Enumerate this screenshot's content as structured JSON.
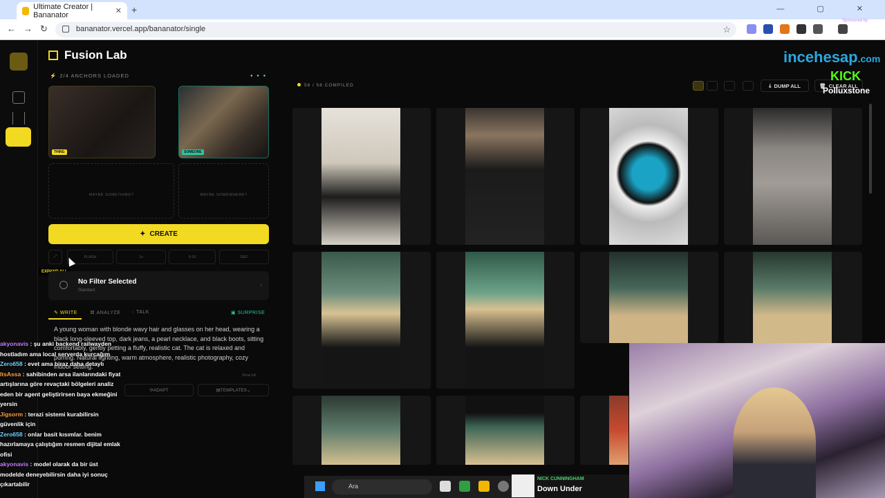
{
  "browser": {
    "tab_title": "Ultimate Creator | Bananator",
    "url": "bananator.vercel.app/bananator/single"
  },
  "app": {
    "title": "Fusion Lab",
    "anchors_status": "2/4 ANCHORS LOADED",
    "anchors": [
      {
        "tag": "THING"
      },
      {
        "tag": "SOMEONE"
      }
    ],
    "empty_slots": [
      "MAYBE SOMETHING?",
      "MAYBE SOMEWHERE?"
    ],
    "create_label": "CREATE",
    "tools": [
      "FLASH",
      "1x",
      "9:16",
      "DEF"
    ],
    "expand_tooltip": "EXPAND ALL",
    "filter": {
      "title": "No Filter Selected",
      "subtitle": "Standard"
    },
    "modes": {
      "write": "WRITE",
      "analyze": "ANALYZE",
      "talk": "TALK",
      "surprise": "SURPRISE"
    },
    "prompt_text": "A young woman with blonde wavy hair and glasses on her head, wearing a black long-sleeved top, dark jeans, a pearl necklace, and black boots, sitting comfortably, gently petting a fluffy, realistic cat. The cat is relaxed and purring. Natural lighting, warm atmosphere, realistic photography, cozy indoor setting.",
    "show_full": "Show full",
    "adapt_label": "ADAPT",
    "templates_label": "TEMPLATES"
  },
  "gallery": {
    "compiled": "56 / 56 COMPILED",
    "dump_all": "DUMP ALL",
    "clear_all": "CLEAR ALL"
  },
  "overlay": {
    "brand": "incehesap",
    "brand_suffix": ".com",
    "kick": "KICK",
    "streamer": "Polluxstone",
    "sponsored": "Sponsored by"
  },
  "chat": [
    {
      "user": "akyonavis",
      "text": "şu anki backend railwayden hostladım ama local serverda kurcağım"
    },
    {
      "user": "Zero658",
      "text": "evet ama biraz daha detaylı"
    },
    {
      "user": "ItsAssa",
      "text": "sahibinden arsa ilanlarındaki fiyat artışlarına göre revaçtaki bölgeleri analiz eden bir agent geliştirirsen baya ekmeğini yersin"
    },
    {
      "user": "Jigsorm",
      "text": "terazi sistemi kurabilirsin güvenlik için"
    },
    {
      "user": "Zero658",
      "text": "onlar basit kısımlar. benim hazırlamaya çalıştığım resmen dijital emlak ofisi"
    },
    {
      "user": "akyonavis",
      "text": "model olarak da bir üst modelde deneyebilirsin daha iyi sonuç çıkartabilir"
    }
  ],
  "taskbar": {
    "search": "Ara",
    "now_playing_artist": "NICK CUNNINGHAM",
    "now_playing_song": "Down Under"
  },
  "colors": {
    "accent": "#f2d922",
    "teal": "#2ec4a2"
  }
}
